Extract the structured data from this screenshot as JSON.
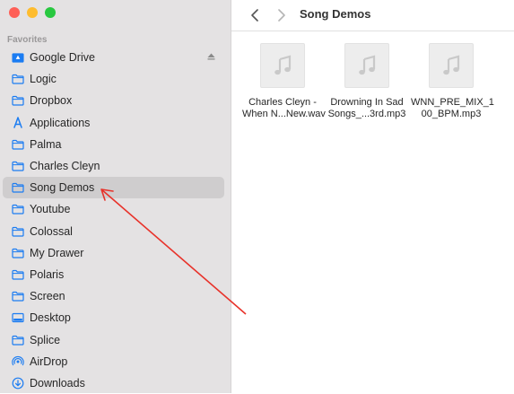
{
  "window": {
    "title": "Song Demos"
  },
  "sidebar": {
    "section": "Favorites",
    "items": [
      {
        "label": "Google Drive",
        "icon": "google-drive-icon"
      },
      {
        "label": "Logic",
        "icon": "folder-icon"
      },
      {
        "label": "Dropbox",
        "icon": "folder-icon"
      },
      {
        "label": "Applications",
        "icon": "applications-icon"
      },
      {
        "label": "Palma",
        "icon": "folder-icon"
      },
      {
        "label": "Charles Cleyn",
        "icon": "folder-icon"
      },
      {
        "label": "Song Demos",
        "icon": "folder-icon"
      },
      {
        "label": "Youtube",
        "icon": "folder-icon"
      },
      {
        "label": "Colossal",
        "icon": "folder-icon"
      },
      {
        "label": "My Drawer",
        "icon": "folder-icon"
      },
      {
        "label": "Polaris",
        "icon": "folder-icon"
      },
      {
        "label": "Screen",
        "icon": "folder-icon"
      },
      {
        "label": "Desktop",
        "icon": "desktop-icon"
      },
      {
        "label": "Splice",
        "icon": "folder-icon"
      },
      {
        "label": "AirDrop",
        "icon": "airdrop-icon"
      },
      {
        "label": "Downloads",
        "icon": "downloads-icon"
      }
    ]
  },
  "files": [
    {
      "line1": "Charles Cleyn -",
      "line2": "When N...New.wav",
      "icon": "music-note-icon"
    },
    {
      "line1": "Drowning In Sad",
      "line2": "Songs_...3rd.mp3",
      "icon": "music-note-icon"
    },
    {
      "line1": "WNN_PRE_MIX_1",
      "line2": "00_BPM.mp3",
      "icon": "music-note-icon"
    }
  ],
  "colors": {
    "accent": "#1b7cf2",
    "annotation": "#e8322a",
    "sidebar_bg": "#e4e2e3",
    "selected_bg": "#cfcdce"
  }
}
